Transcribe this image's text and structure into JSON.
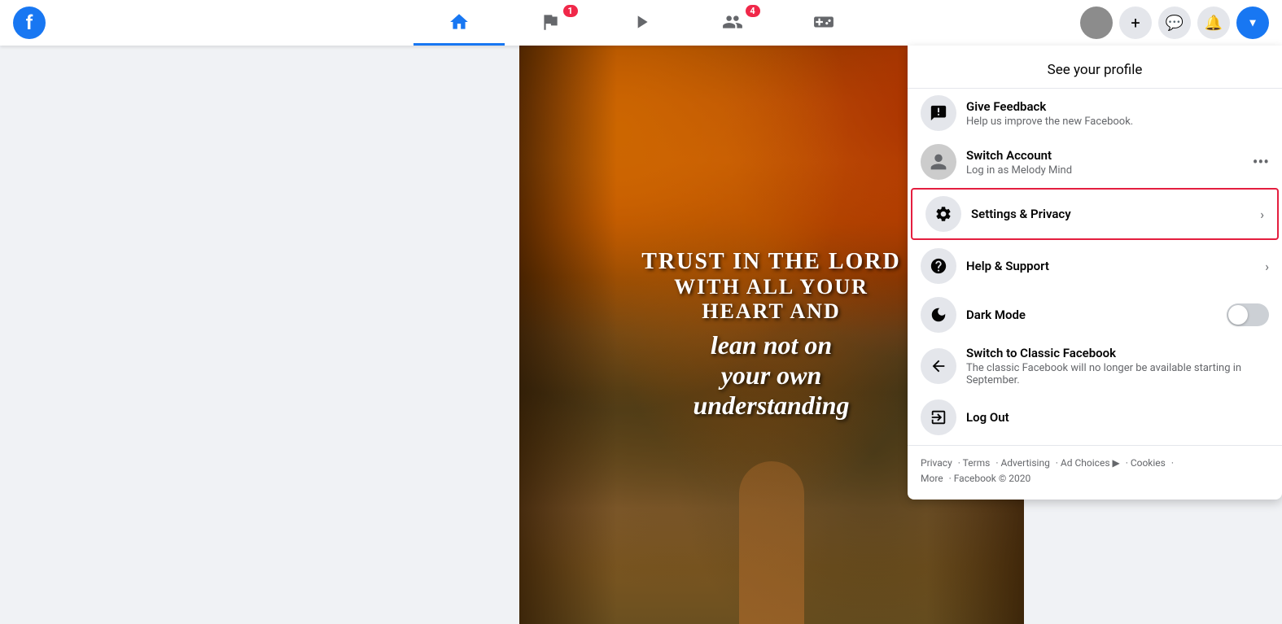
{
  "colors": {
    "blue": "#1877f2",
    "red_badge": "#f02849",
    "highlight_border": "#e41e3f",
    "text_dark": "#050505",
    "text_muted": "#65676b",
    "bg_light": "#e4e6eb",
    "bg_page": "#f0f2f5"
  },
  "topnav": {
    "logo": "f",
    "nav_items": [
      {
        "id": "home",
        "active": true,
        "badge": null,
        "label": "Home",
        "icon": "home"
      },
      {
        "id": "flag",
        "active": false,
        "badge": "1",
        "label": "Feed",
        "icon": "flag"
      },
      {
        "id": "watch",
        "active": false,
        "badge": null,
        "label": "Watch",
        "icon": "play"
      },
      {
        "id": "groups",
        "active": false,
        "badge": "4",
        "label": "Groups",
        "icon": "groups"
      },
      {
        "id": "gaming",
        "active": false,
        "badge": null,
        "label": "Gaming",
        "icon": "gaming"
      }
    ],
    "right_buttons": [
      {
        "id": "add",
        "label": "+",
        "icon": "plus"
      },
      {
        "id": "messenger",
        "label": "💬",
        "icon": "messenger"
      },
      {
        "id": "notifications",
        "label": "🔔",
        "icon": "bell"
      },
      {
        "id": "account",
        "label": "▾",
        "icon": "chevron-down"
      }
    ]
  },
  "post": {
    "text_lines": [
      "Trust in the LORD",
      "WITH ALL YOUR",
      "HEART AND",
      "",
      "lean not on",
      "your own",
      "understanding"
    ]
  },
  "dropdown": {
    "see_profile_label": "See your profile",
    "items": [
      {
        "id": "give-feedback",
        "title": "Give Feedback",
        "subtitle": "Help us improve the new Facebook.",
        "icon": "feedback",
        "has_arrow": false,
        "has_dots": false,
        "is_toggle": false,
        "is_highlighted": false
      },
      {
        "id": "switch-account",
        "title": "Switch Account",
        "subtitle": "Log in as Melody Mind",
        "icon": "account-circle",
        "has_arrow": false,
        "has_dots": true,
        "is_toggle": false,
        "is_highlighted": false
      },
      {
        "id": "settings-privacy",
        "title": "Settings & Privacy",
        "subtitle": "",
        "icon": "gear",
        "has_arrow": true,
        "has_dots": false,
        "is_toggle": false,
        "is_highlighted": true
      },
      {
        "id": "help-support",
        "title": "Help & Support",
        "subtitle": "",
        "icon": "question",
        "has_arrow": true,
        "has_dots": false,
        "is_toggle": false,
        "is_highlighted": false
      },
      {
        "id": "dark-mode",
        "title": "Dark Mode",
        "subtitle": "",
        "icon": "moon",
        "has_arrow": false,
        "has_dots": false,
        "is_toggle": true,
        "is_highlighted": false
      },
      {
        "id": "classic-facebook",
        "title": "Switch to Classic Facebook",
        "subtitle": "The classic Facebook will no longer be available starting in September.",
        "icon": "back-arrow",
        "has_arrow": false,
        "has_dots": false,
        "is_toggle": false,
        "is_highlighted": false
      },
      {
        "id": "log-out",
        "title": "Log Out",
        "subtitle": "",
        "icon": "logout",
        "has_arrow": false,
        "has_dots": false,
        "is_toggle": false,
        "is_highlighted": false
      }
    ],
    "footer": {
      "links": "Privacy · Terms · Advertising · Ad Choices · Cookies ·",
      "more": "More · Facebook © 2020"
    }
  }
}
